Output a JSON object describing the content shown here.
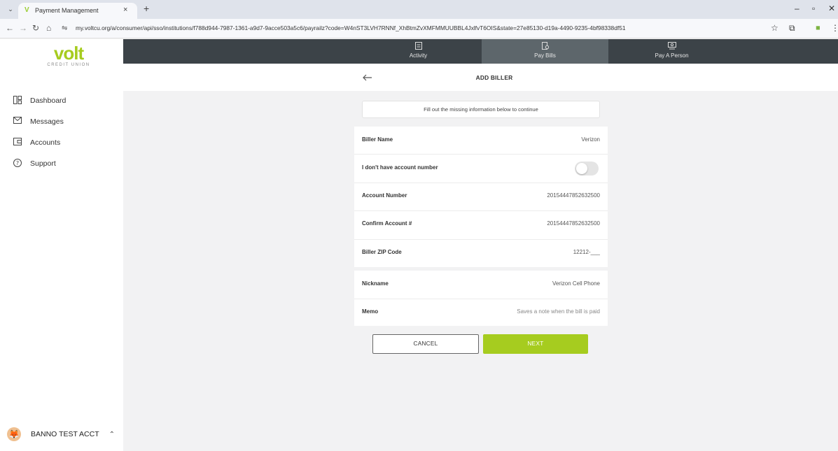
{
  "browser": {
    "tab_title": "Payment Management",
    "tab_close": "×",
    "new_tab": "+",
    "url": "my.voltcu.org/a/consumer/api/sso/institutions/f788d944-7987-1361-a9d7-9acce503a5c6/payrailz?code=W4nST3LVH7RNNf_XhBtmZvXMFMMUUBBL4JxlfvT6OIS&state=27e85130-d19a-4490-9235-4bf98338df51",
    "minimize": "–",
    "restore": "▫",
    "close": "✕"
  },
  "brand": {
    "name": "volt",
    "subtitle": "CREDIT UNION",
    "accent": "#a6cc1f"
  },
  "sidebar": {
    "items": [
      {
        "label": "Dashboard",
        "icon": "dashboard-icon"
      },
      {
        "label": "Messages",
        "icon": "envelope-icon"
      },
      {
        "label": "Accounts",
        "icon": "wallet-icon"
      },
      {
        "label": "Support",
        "icon": "help-circle-icon"
      }
    ],
    "user_name": "BANNO TEST ACCT"
  },
  "topnav": {
    "tabs": [
      {
        "label": "Activity",
        "icon": "activity-icon",
        "active": false
      },
      {
        "label": "Pay Bills",
        "icon": "bill-icon",
        "active": true
      },
      {
        "label": "Pay A Person",
        "icon": "person-pay-icon",
        "active": false
      }
    ]
  },
  "header": {
    "title": "ADD BILLER"
  },
  "notice": "Fill out the missing information below to continue",
  "form": {
    "biller_name": {
      "label": "Biller Name",
      "value": "Verizon"
    },
    "no_account": {
      "label": "I don't have account number",
      "checked": false
    },
    "account_number": {
      "label": "Account Number",
      "value": "20154447852632500"
    },
    "confirm_account": {
      "label": "Confirm Account #",
      "value": "20154447852632500"
    },
    "zip": {
      "label": "Biller ZIP Code",
      "value": "12212-___"
    },
    "nickname": {
      "label": "Nickname",
      "value": "Verizon Cell Phone"
    },
    "memo": {
      "label": "Memo",
      "placeholder": "Saves a note when the bill is paid"
    }
  },
  "actions": {
    "cancel": "CANCEL",
    "next": "NEXT"
  }
}
